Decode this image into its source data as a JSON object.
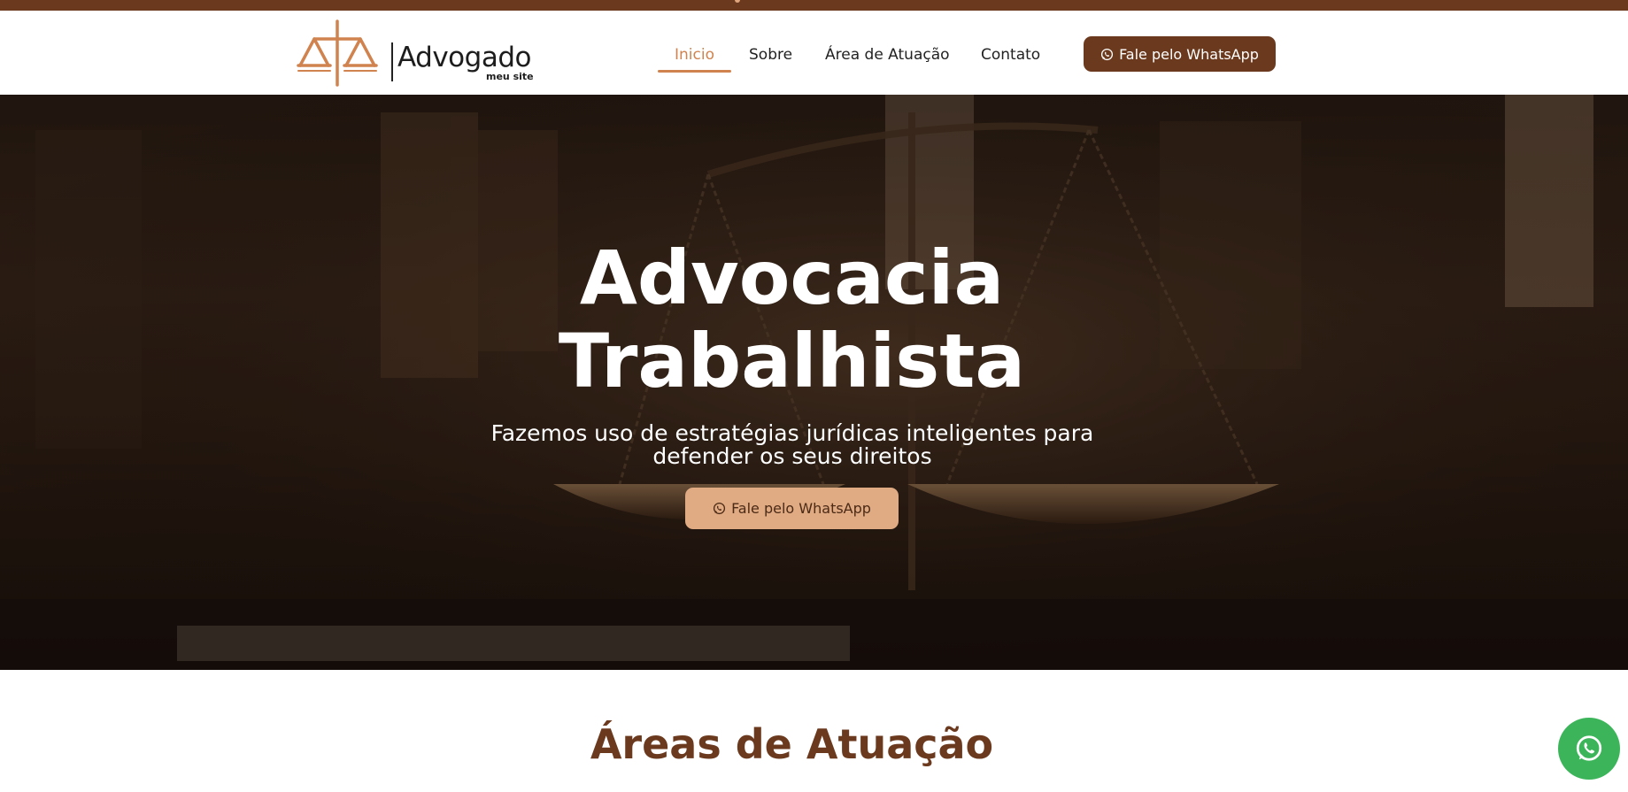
{
  "brand": {
    "name": "Advogado",
    "tagline": "meu site",
    "accent": "#d0834e",
    "primary": "#6b3a1e",
    "cta_light": "#e0ab83",
    "whatsapp_green": "#3cb55a",
    "logo_icon": "scales-icon"
  },
  "nav": {
    "items": [
      {
        "label": "Inicio",
        "active": true
      },
      {
        "label": "Sobre",
        "active": false
      },
      {
        "label": "Área de Atuação",
        "active": false
      },
      {
        "label": "Contato",
        "active": false
      }
    ],
    "cta_label": "Fale pelo WhatsApp",
    "cta_icon": "whatsapp-icon"
  },
  "hero": {
    "title_line1": "Advocacia",
    "title_line2": "Trabalhista",
    "subtitle_line1": "Fazemos uso de estratégias jurídicas inteligentes para",
    "subtitle_line2": "defender os seus direitos",
    "cta_label": "Fale pelo WhatsApp",
    "cta_icon": "whatsapp-icon",
    "background": "scales-of-justice-photo"
  },
  "section": {
    "title": "Áreas de Atuação"
  },
  "floating_button": {
    "icon": "whatsapp-icon"
  }
}
